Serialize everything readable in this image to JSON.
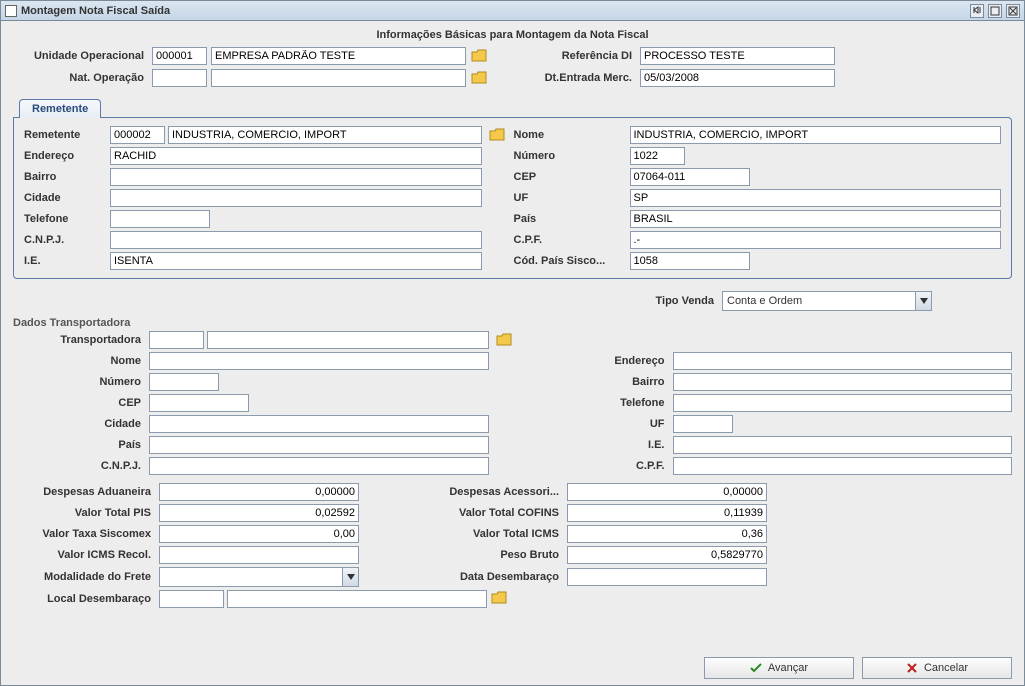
{
  "window": {
    "title": "Montagem Nota Fiscal Saída"
  },
  "section_title": "Informações Básicas para Montagem da Nota Fiscal",
  "basic": {
    "unidade_label": "Unidade Operacional",
    "unidade_code": "000001",
    "unidade_desc": "EMPRESA PADRÃO TESTE",
    "ref_di_label": "Referência DI",
    "ref_di_val": "PROCESSO TESTE",
    "nat_op_label": "Nat. Operação",
    "nat_op_val": "",
    "dt_ent_label": "Dt.Entrada Merc.",
    "dt_ent_val": "05/03/2008"
  },
  "remetente": {
    "tab_label": "Remetente",
    "remetente_label": "Remetente",
    "remetente_code": "000002",
    "remetente_desc": "INDUSTRIA, COMERCIO, IMPORT",
    "nome_label": "Nome",
    "nome_val": "INDUSTRIA, COMERCIO, IMPORT",
    "endereco_label": "Endereço",
    "endereco_val": "RACHID",
    "numero_label": "Número",
    "numero_val": "1022",
    "bairro_label": "Bairro",
    "bairro_val": "",
    "cep_label": "CEP",
    "cep_val": "07064-011",
    "cidade_label": "Cidade",
    "cidade_val": "",
    "uf_label": "UF",
    "uf_val": "SP",
    "telefone_label": "Telefone",
    "telefone_val": "",
    "pais_label": "País",
    "pais_val": "BRASIL",
    "cnpj_label": "C.N.P.J.",
    "cnpj_val": "",
    "cpf_label": "C.P.F.",
    "cpf_val": ".-",
    "ie_label": "I.E.",
    "ie_val": "ISENTA",
    "cod_pais_label": "Cód. País Sisco...",
    "cod_pais_val": "1058"
  },
  "tipo_venda": {
    "label": "Tipo Venda",
    "selected": "Conta e Ordem"
  },
  "trans": {
    "section": "Dados Transportadora",
    "transportadora_label": "Transportadora",
    "transportadora_code": "",
    "transportadora_desc": "",
    "nome_label": "Nome",
    "nome_val": "",
    "endereco_label": "Endereço",
    "endereco_val": "",
    "numero_label": "Número",
    "numero_val": "",
    "bairro_label": "Bairro",
    "bairro_val": "",
    "cep_label": "CEP",
    "cep_val": "",
    "telefone_label": "Telefone",
    "telefone_val": "",
    "cidade_label": "Cidade",
    "cidade_val": "",
    "uf_label": "UF",
    "uf_val": "",
    "pais_label": "País",
    "pais_val": "",
    "ie_label": "I.E.",
    "ie_val": "",
    "cnpj_label": "C.N.P.J.",
    "cnpj_val": "",
    "cpf_label": "C.P.F.",
    "cpf_val": ""
  },
  "totals": {
    "desp_aduaneira_label": "Despesas Aduaneira",
    "desp_aduaneira_val": "0,00000",
    "desp_acessoria_label": "Despesas Acessori...",
    "desp_acessoria_val": "0,00000",
    "valor_pis_label": "Valor Total PIS",
    "valor_pis_val": "0,02592",
    "valor_cofins_label": "Valor Total COFINS",
    "valor_cofins_val": "0,11939",
    "taxa_siscomex_label": "Valor Taxa Siscomex",
    "taxa_siscomex_val": "0,00",
    "valor_icms_label": "Valor Total ICMS",
    "valor_icms_val": "0,36",
    "icms_recol_label": "Valor ICMS Recol.",
    "icms_recol_val": "",
    "peso_bruto_label": "Peso Bruto",
    "peso_bruto_val": "0,5829770",
    "modalidade_label": "Modalidade do Frete",
    "modalidade_val": "",
    "data_desemb_label": "Data Desembaraço",
    "data_desemb_val": "",
    "local_desemb_label": "Local Desembaraço",
    "local_desemb_code": "",
    "local_desemb_desc": ""
  },
  "buttons": {
    "avancar": "Avançar",
    "cancelar": "Cancelar"
  }
}
